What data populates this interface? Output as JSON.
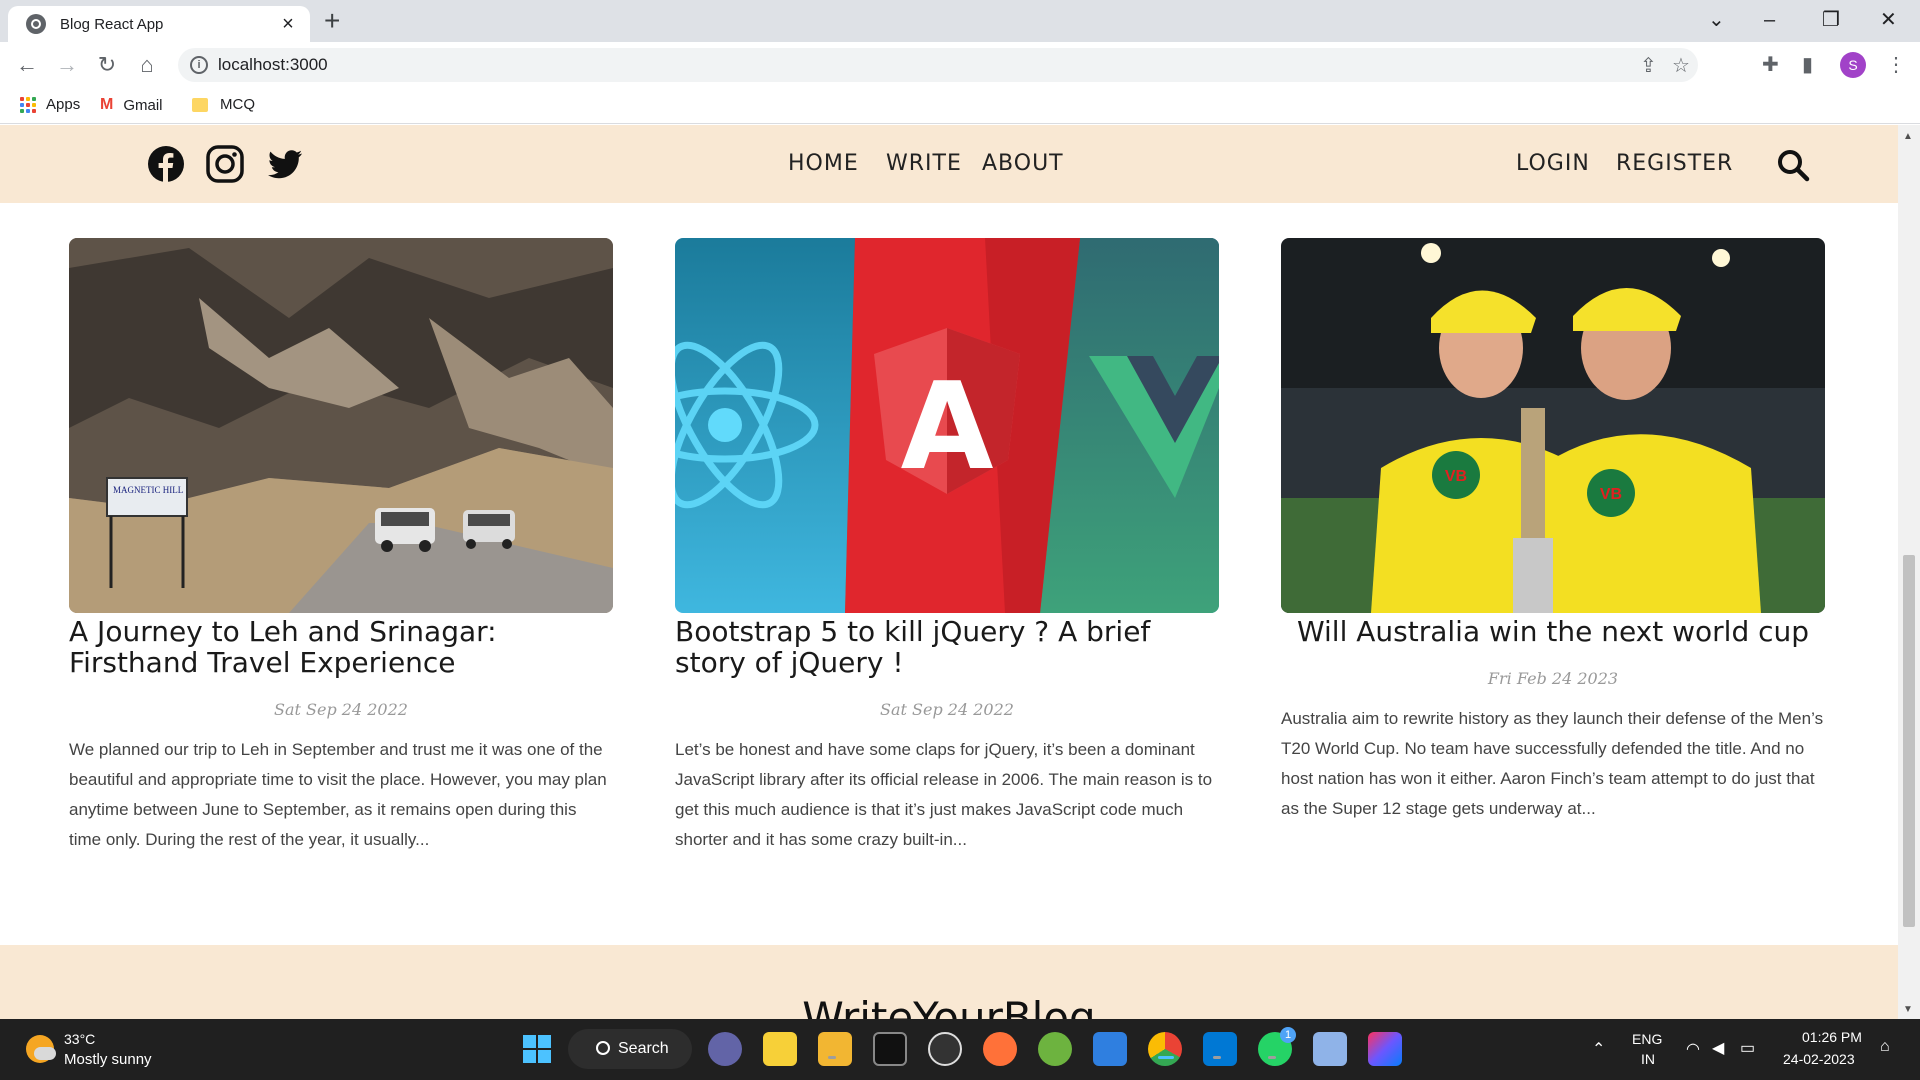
{
  "browser": {
    "tab_title": "Blog React App",
    "url": "localhost:3000",
    "profile_initial": "S",
    "bookmarks": [
      "Apps",
      "Gmail",
      "MCQ"
    ]
  },
  "site": {
    "menu": [
      "HOME",
      "WRITE",
      "ABOUT"
    ],
    "auth": [
      "LOGIN",
      "REGISTER"
    ],
    "posts": [
      {
        "title": "A Journey to Leh and Srinagar: Firsthand Travel Experience",
        "date": "Sat Sep 24 2022",
        "desc": "We planned our trip to Leh in September and trust me it was one of the beautiful and appropriate time to visit the place. However, you may plan anytime between June to September, as it remains open during this time only. During the rest of the year, it usually...",
        "sign_text": "MAGNETIC HILL"
      },
      {
        "title": "Bootstrap 5 to kill jQuery ? A brief story of jQuery !",
        "date": "Sat Sep 24 2022",
        "desc": "Let’s be honest and have some claps for jQuery, it’s been a dominant JavaScript library after its official release in 2006. The main reason is to get this much audience is that it’s just makes JavaScript code much shorter and it has some crazy built-in...",
        "logo_letter": "A"
      },
      {
        "title": "Will Australia win the next world cup",
        "date": "Fri Feb 24 2023",
        "desc": "Australia aim to rewrite history as they launch their defense of the Men’s T20 World Cup. No team have successfully defended the title. And no host nation has won it either. Aaron Finch’s team attempt to do just that as the Super 12 stage gets underway at...",
        "badge_text": "VB"
      }
    ],
    "footer_title": "WriteYourBlog"
  },
  "taskbar": {
    "temp": "33°C",
    "weather": "Mostly sunny",
    "search": "Search",
    "lang_top": "ENG",
    "lang_bottom": "IN",
    "time": "01:26 PM",
    "date": "24-02-2023",
    "whatsapp_badge": "1"
  },
  "colors": {
    "nav_bg": "#f9e8d3",
    "chrome_bg": "#dee1e6",
    "taskbar_bg": "#202020",
    "profile": "#a142c8"
  }
}
